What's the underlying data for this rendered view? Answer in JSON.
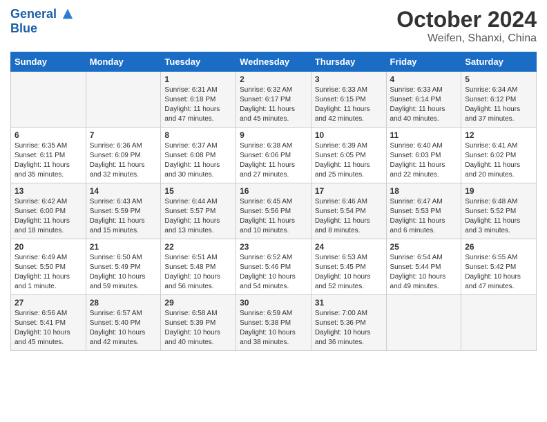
{
  "header": {
    "logo_line1": "General",
    "logo_line2": "Blue",
    "month_title": "October 2024",
    "location": "Weifen, Shanxi, China"
  },
  "days_of_week": [
    "Sunday",
    "Monday",
    "Tuesday",
    "Wednesday",
    "Thursday",
    "Friday",
    "Saturday"
  ],
  "weeks": [
    [
      {
        "day": "",
        "info": ""
      },
      {
        "day": "",
        "info": ""
      },
      {
        "day": "1",
        "info": "Sunrise: 6:31 AM\nSunset: 6:18 PM\nDaylight: 11 hours and 47 minutes."
      },
      {
        "day": "2",
        "info": "Sunrise: 6:32 AM\nSunset: 6:17 PM\nDaylight: 11 hours and 45 minutes."
      },
      {
        "day": "3",
        "info": "Sunrise: 6:33 AM\nSunset: 6:15 PM\nDaylight: 11 hours and 42 minutes."
      },
      {
        "day": "4",
        "info": "Sunrise: 6:33 AM\nSunset: 6:14 PM\nDaylight: 11 hours and 40 minutes."
      },
      {
        "day": "5",
        "info": "Sunrise: 6:34 AM\nSunset: 6:12 PM\nDaylight: 11 hours and 37 minutes."
      }
    ],
    [
      {
        "day": "6",
        "info": "Sunrise: 6:35 AM\nSunset: 6:11 PM\nDaylight: 11 hours and 35 minutes."
      },
      {
        "day": "7",
        "info": "Sunrise: 6:36 AM\nSunset: 6:09 PM\nDaylight: 11 hours and 32 minutes."
      },
      {
        "day": "8",
        "info": "Sunrise: 6:37 AM\nSunset: 6:08 PM\nDaylight: 11 hours and 30 minutes."
      },
      {
        "day": "9",
        "info": "Sunrise: 6:38 AM\nSunset: 6:06 PM\nDaylight: 11 hours and 27 minutes."
      },
      {
        "day": "10",
        "info": "Sunrise: 6:39 AM\nSunset: 6:05 PM\nDaylight: 11 hours and 25 minutes."
      },
      {
        "day": "11",
        "info": "Sunrise: 6:40 AM\nSunset: 6:03 PM\nDaylight: 11 hours and 22 minutes."
      },
      {
        "day": "12",
        "info": "Sunrise: 6:41 AM\nSunset: 6:02 PM\nDaylight: 11 hours and 20 minutes."
      }
    ],
    [
      {
        "day": "13",
        "info": "Sunrise: 6:42 AM\nSunset: 6:00 PM\nDaylight: 11 hours and 18 minutes."
      },
      {
        "day": "14",
        "info": "Sunrise: 6:43 AM\nSunset: 5:59 PM\nDaylight: 11 hours and 15 minutes."
      },
      {
        "day": "15",
        "info": "Sunrise: 6:44 AM\nSunset: 5:57 PM\nDaylight: 11 hours and 13 minutes."
      },
      {
        "day": "16",
        "info": "Sunrise: 6:45 AM\nSunset: 5:56 PM\nDaylight: 11 hours and 10 minutes."
      },
      {
        "day": "17",
        "info": "Sunrise: 6:46 AM\nSunset: 5:54 PM\nDaylight: 11 hours and 8 minutes."
      },
      {
        "day": "18",
        "info": "Sunrise: 6:47 AM\nSunset: 5:53 PM\nDaylight: 11 hours and 6 minutes."
      },
      {
        "day": "19",
        "info": "Sunrise: 6:48 AM\nSunset: 5:52 PM\nDaylight: 11 hours and 3 minutes."
      }
    ],
    [
      {
        "day": "20",
        "info": "Sunrise: 6:49 AM\nSunset: 5:50 PM\nDaylight: 11 hours and 1 minute."
      },
      {
        "day": "21",
        "info": "Sunrise: 6:50 AM\nSunset: 5:49 PM\nDaylight: 10 hours and 59 minutes."
      },
      {
        "day": "22",
        "info": "Sunrise: 6:51 AM\nSunset: 5:48 PM\nDaylight: 10 hours and 56 minutes."
      },
      {
        "day": "23",
        "info": "Sunrise: 6:52 AM\nSunset: 5:46 PM\nDaylight: 10 hours and 54 minutes."
      },
      {
        "day": "24",
        "info": "Sunrise: 6:53 AM\nSunset: 5:45 PM\nDaylight: 10 hours and 52 minutes."
      },
      {
        "day": "25",
        "info": "Sunrise: 6:54 AM\nSunset: 5:44 PM\nDaylight: 10 hours and 49 minutes."
      },
      {
        "day": "26",
        "info": "Sunrise: 6:55 AM\nSunset: 5:42 PM\nDaylight: 10 hours and 47 minutes."
      }
    ],
    [
      {
        "day": "27",
        "info": "Sunrise: 6:56 AM\nSunset: 5:41 PM\nDaylight: 10 hours and 45 minutes."
      },
      {
        "day": "28",
        "info": "Sunrise: 6:57 AM\nSunset: 5:40 PM\nDaylight: 10 hours and 42 minutes."
      },
      {
        "day": "29",
        "info": "Sunrise: 6:58 AM\nSunset: 5:39 PM\nDaylight: 10 hours and 40 minutes."
      },
      {
        "day": "30",
        "info": "Sunrise: 6:59 AM\nSunset: 5:38 PM\nDaylight: 10 hours and 38 minutes."
      },
      {
        "day": "31",
        "info": "Sunrise: 7:00 AM\nSunset: 5:36 PM\nDaylight: 10 hours and 36 minutes."
      },
      {
        "day": "",
        "info": ""
      },
      {
        "day": "",
        "info": ""
      }
    ]
  ]
}
